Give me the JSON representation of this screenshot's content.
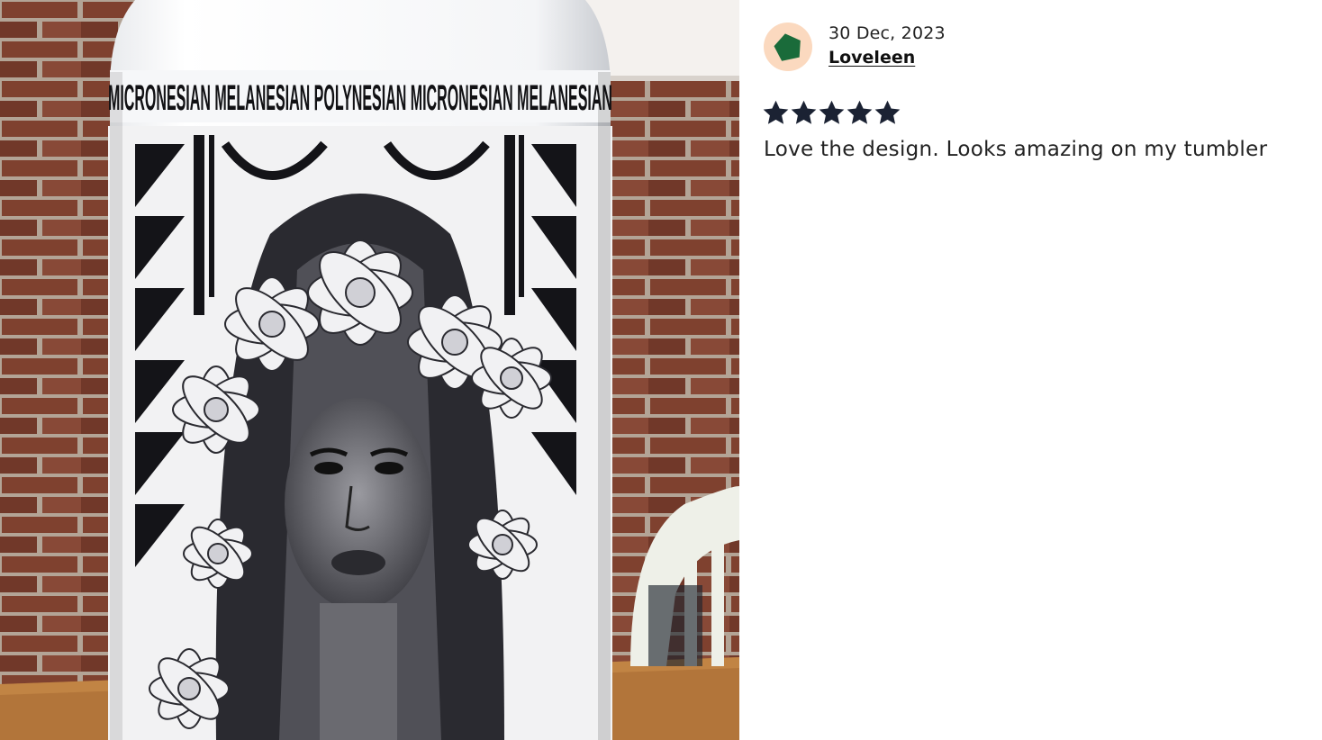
{
  "review": {
    "date": "30 Dec, 2023",
    "reviewer_name": "Loveleen",
    "rating": 5,
    "rating_max": 5,
    "text": "Love the design. Looks amazing on my tumbler"
  },
  "photo": {
    "tumbler_text": "MICRONESIAN MELANESIAN POLYNESIAN MICRONESIAN MELANESIAN"
  },
  "colors": {
    "avatar_bg": "#fbd9bf",
    "avatar_shape": "#1a6b3a",
    "star": "#1b2233",
    "brick": "#8a4b3a"
  },
  "icons": {
    "avatar": "pentagon-avatar-icon",
    "star": "star-icon"
  }
}
